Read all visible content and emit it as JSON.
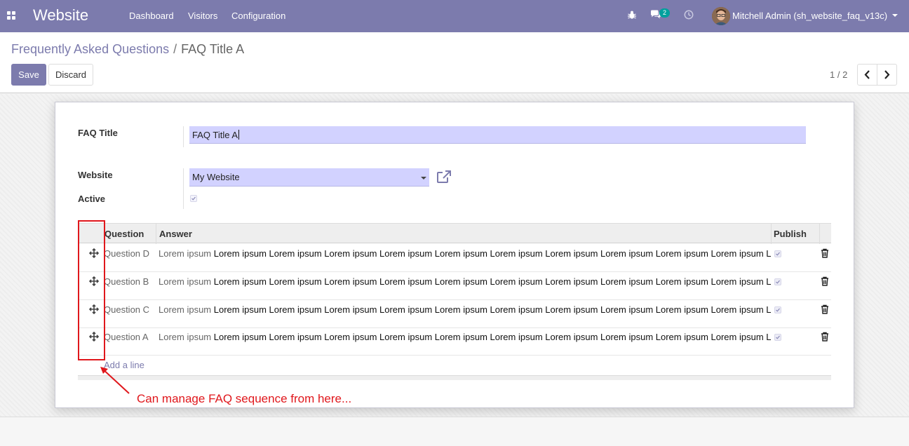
{
  "navbar": {
    "app_name": "Website",
    "menu": [
      "Dashboard",
      "Visitors",
      "Configuration"
    ],
    "messages_count": "2",
    "user": "Mitchell Admin (sh_website_faq_v13c)",
    "color": "#7c7bad"
  },
  "breadcrumb": {
    "parent": "Frequently Asked Questions",
    "separator": "/",
    "current": "FAQ Title A"
  },
  "actions": {
    "save": "Save",
    "discard": "Discard"
  },
  "pager": {
    "value": "1 / 2"
  },
  "form": {
    "title_label": "FAQ Title",
    "title_value": "FAQ Title A",
    "website_label": "Website",
    "website_value": "My Website",
    "active_label": "Active",
    "active_checked": true
  },
  "faq_table": {
    "columns": [
      "Question",
      "Answer",
      "Publish"
    ],
    "rows": [
      {
        "question": "Question D",
        "answer_muted": "Lorem ipsum",
        "answer": "Lorem ipsum Lorem ipsum Lorem ipsum Lorem ipsum Lorem ipsum Lorem ipsum Lorem ipsum Lorem ipsum Lorem ipsum Lorem ipsum Lorem ipsum L",
        "published": true
      },
      {
        "question": "Question B",
        "answer_muted": "Lorem ipsum",
        "answer": "Lorem ipsum Lorem ipsum Lorem ipsum Lorem ipsum Lorem ipsum Lorem ipsum Lorem ipsum Lorem ipsum Lorem ipsum Lorem ipsum Lorem ipsum L",
        "published": true
      },
      {
        "question": "Question C",
        "answer_muted": "Lorem ipsum",
        "answer": "Lorem ipsum Lorem ipsum Lorem ipsum Lorem ipsum Lorem ipsum Lorem ipsum Lorem ipsum Lorem ipsum Lorem ipsum Lorem ipsum Lorem ipsum L",
        "published": true
      },
      {
        "question": "Question A",
        "answer_muted": "Lorem ipsum",
        "answer": "Lorem ipsum Lorem ipsum Lorem ipsum Lorem ipsum Lorem ipsum Lorem ipsum Lorem ipsum Lorem ipsum Lorem ipsum Lorem ipsum Lorem ipsum L",
        "published": true
      }
    ],
    "add_line": "Add a line"
  },
  "annotation": {
    "text": "Can manage FAQ sequence from here...",
    "color": "#e0171c"
  }
}
